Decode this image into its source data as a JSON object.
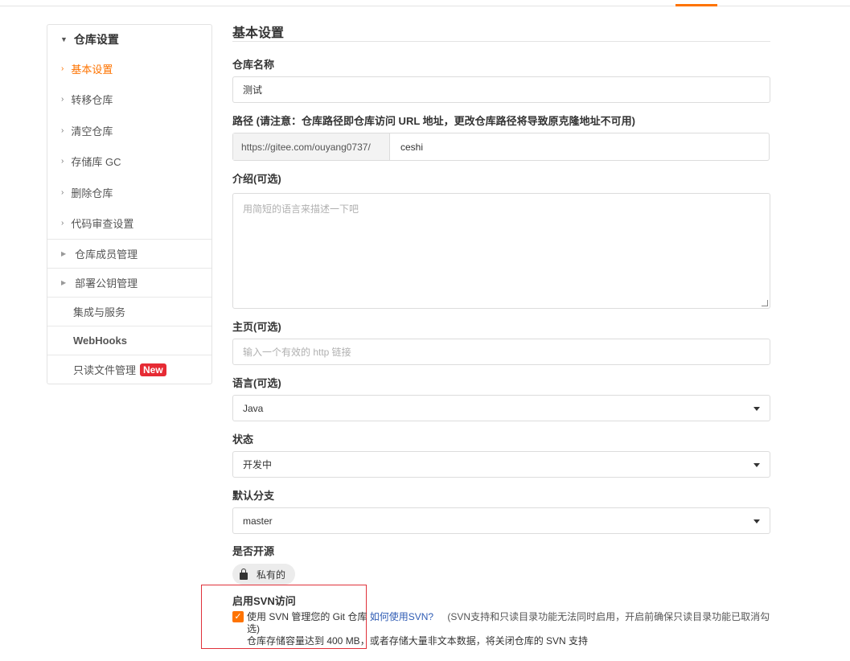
{
  "sidebar": {
    "header": "仓库设置",
    "items": [
      {
        "label": "基本设置",
        "active": true
      },
      {
        "label": "转移仓库"
      },
      {
        "label": "清空仓库"
      },
      {
        "label": "存储库 GC"
      },
      {
        "label": "删除仓库"
      },
      {
        "label": "代码审查设置"
      }
    ],
    "groups": [
      {
        "label": "仓库成员管理"
      },
      {
        "label": "部署公钥管理"
      },
      {
        "label": "集成与服务"
      },
      {
        "label": "WebHooks"
      },
      {
        "label": "只读文件管理",
        "badge": "New"
      }
    ]
  },
  "main": {
    "title": "基本设置",
    "repo_name_label": "仓库名称",
    "repo_name_value": "测试",
    "path_label": "路径 (请注意：仓库路径即仓库访问 URL 地址，更改仓库路径将导致原克隆地址不可用)",
    "path_prefix": "https://gitee.com/ouyang0737/",
    "path_value": "ceshi",
    "intro_label": "介绍(可选)",
    "intro_placeholder": "用简短的语言来描述一下吧",
    "homepage_label": "主页(可选)",
    "homepage_placeholder": "输入一个有效的 http 链接",
    "language_label": "语言(可选)",
    "language_value": "Java",
    "status_label": "状态",
    "status_value": "开发中",
    "branch_label": "默认分支",
    "branch_value": "master",
    "opensource_label": "是否开源",
    "visibility_value": "私有的",
    "svn_label": "启用SVN访问",
    "svn_checkbox_text": "使用 SVN 管理您的 Git 仓库",
    "svn_link": "如何使用SVN?",
    "svn_note_line1": "(SVN支持和只读目录功能无法同时启用，开启前确保只读目录功能已取消勾",
    "svn_note_line1b": "选)",
    "svn_note_line2": "仓库存储容量达到 400 MB，或者存储大量非文本数据，将关闭仓库的 SVN 支持"
  },
  "colors": {
    "accent": "#fe7300",
    "badge": "#e62b34",
    "link": "#2f5cb4",
    "highlight_box": "#e0323a"
  }
}
